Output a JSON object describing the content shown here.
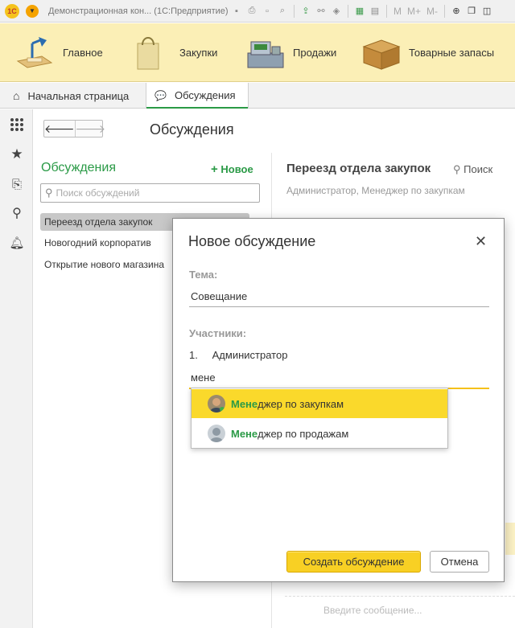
{
  "window": {
    "title": "Демонстрационная кон... (1С:Предприятие)",
    "logo": "1C",
    "toolbar_text": [
      "M",
      "M+",
      "M-"
    ]
  },
  "sections": [
    {
      "label": "Главное",
      "icon": "desk-lamp-icon"
    },
    {
      "label": "Закупки",
      "icon": "shopping-bag-icon"
    },
    {
      "label": "Продажи",
      "icon": "cash-register-icon"
    },
    {
      "label": "Товарные запасы",
      "icon": "box-icon"
    }
  ],
  "tabs": [
    {
      "label": "Начальная страница",
      "icon": "home-icon"
    },
    {
      "label": "Обсуждения",
      "icon": "chat-icon"
    }
  ],
  "page": {
    "title": "Обсуждения"
  },
  "discussions": {
    "title": "Обсуждения",
    "new_label": "Новое",
    "search_placeholder": "Поиск обсуждений",
    "items": [
      "Переезд отдела закупок",
      "Новогодний корпоратив",
      "Открытие нового магазина"
    ]
  },
  "detail": {
    "title": "Переезд отдела закупок",
    "search_label": "Поиск",
    "participants": "Администратор, Менеджер по закупкам",
    "message_placeholder": "Введите сообщение..."
  },
  "dialog": {
    "title": "Новое обсуждение",
    "topic_label": "Тема:",
    "topic_value": "Совещание",
    "participants_label": "Участники:",
    "participant_number": "1.",
    "participant_name": "Администратор",
    "participant_input": "мене",
    "suggestions": [
      {
        "match": "Мене",
        "rest": "джер по закупкам"
      },
      {
        "match": "Мене",
        "rest": "джер по продажам"
      }
    ],
    "create_label": "Создать обсуждение",
    "cancel_label": "Отмена"
  },
  "colors": {
    "accent": "#2a9a46",
    "highlight": "#fad92b",
    "sections_bg": "#fbefb6"
  }
}
